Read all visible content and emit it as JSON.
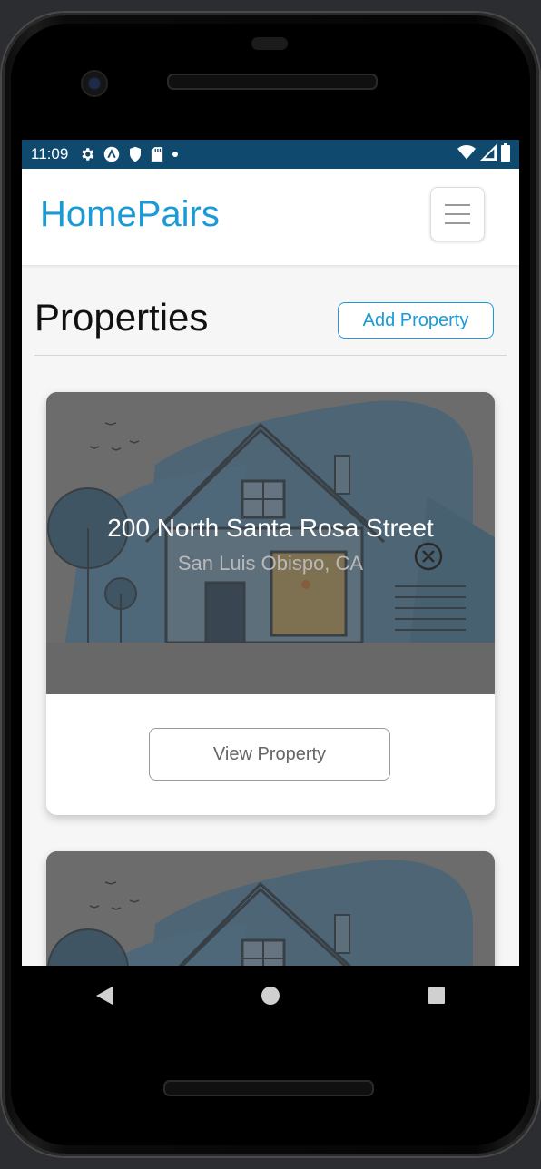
{
  "status_bar": {
    "time": "11:09",
    "left_icons": [
      "gear-icon",
      "app-a-icon",
      "shield-icon",
      "sd-card-icon",
      "dot-icon"
    ],
    "right_icons": [
      "wifi-icon",
      "signal-icon",
      "battery-icon"
    ],
    "background": "#0f4a6e"
  },
  "app_bar": {
    "brand": "HomePairs",
    "brand_color": "#1a9ad6",
    "menu_icon": "hamburger-icon"
  },
  "page": {
    "title": "Properties",
    "add_button_label": "Add Property"
  },
  "properties": [
    {
      "address": "200 North Santa Rosa Street",
      "city": "San Luis Obispo, CA",
      "view_label": "View Property",
      "close_icon": "close-circle-icon"
    },
    {
      "address": "",
      "city": "",
      "view_label": ""
    }
  ],
  "nav_bar": {
    "back_icon": "back-triangle-icon",
    "home_icon": "home-circle-icon",
    "recents_icon": "recents-square-icon"
  }
}
